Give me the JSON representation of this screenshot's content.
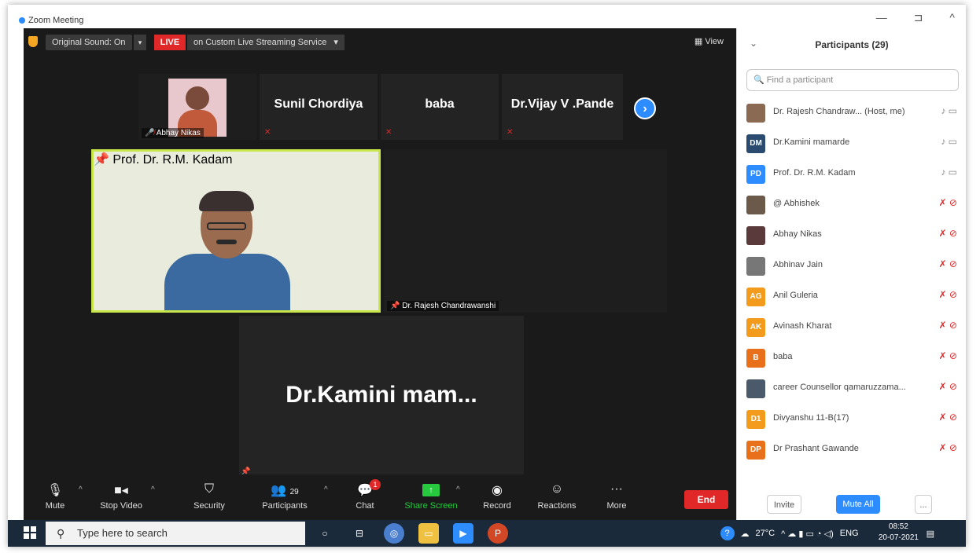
{
  "window": {
    "title": "Zoom Meeting",
    "minimize": "—",
    "restore": "⊐",
    "close": "^"
  },
  "topbar": {
    "original_sound": "Original Sound: On",
    "live": "LIVE",
    "stream": "on Custom Live Streaming Service",
    "view": "View"
  },
  "tiles": [
    {
      "name": "Abhay Nikas"
    },
    {
      "name": "Sunil Chordiya"
    },
    {
      "name": "baba"
    },
    {
      "name": "Dr.Vijay V .Pande"
    }
  ],
  "main_video": {
    "label": "Prof. Dr. R.M. Kadam"
  },
  "second_video": {
    "label": "Dr. Rajesh Chandrawanshi"
  },
  "third_video": {
    "name": "Dr.Kamini  mam..."
  },
  "toolbar": {
    "mute": "Mute",
    "stop_video": "Stop Video",
    "security": "Security",
    "participants": "Participants",
    "participants_count": "29",
    "chat": "Chat",
    "chat_badge": "1",
    "share_screen": "Share Screen",
    "record": "Record",
    "reactions": "Reactions",
    "more": "More",
    "end": "End"
  },
  "panel": {
    "title": "Participants (29)",
    "search_placeholder": "Find a participant",
    "participants": [
      {
        "initials": "",
        "name": "Dr. Rajesh Chandraw...  (Host, me)",
        "color": "#8a6a52",
        "muted": false
      },
      {
        "initials": "DM",
        "name": "Dr.Kamini mamarde",
        "color": "#2b4a6f",
        "muted": false
      },
      {
        "initials": "PD",
        "name": "Prof. Dr. R.M. Kadam",
        "color": "#2d8cff",
        "muted": false
      },
      {
        "initials": "",
        "name": "@ Abhishek",
        "color": "#6b5a4a",
        "muted": true
      },
      {
        "initials": "",
        "name": "Abhay Nikas",
        "color": "#5a3a3a",
        "muted": true
      },
      {
        "initials": "",
        "name": "Abhinav Jain",
        "color": "#777777",
        "muted": true
      },
      {
        "initials": "AG",
        "name": "Anil Guleria",
        "color": "#f29b1d",
        "muted": true
      },
      {
        "initials": "AK",
        "name": "Avinash Kharat",
        "color": "#f29b1d",
        "muted": true
      },
      {
        "initials": "B",
        "name": "baba",
        "color": "#e8701a",
        "muted": true
      },
      {
        "initials": "",
        "name": "career Counsellor qamaruzzama...",
        "color": "#4a5a6a",
        "muted": true
      },
      {
        "initials": "D1",
        "name": "Divyanshu 11-B(17)",
        "color": "#f29b1d",
        "muted": true
      },
      {
        "initials": "DP",
        "name": "Dr Prashant Gawande",
        "color": "#e8701a",
        "muted": true
      }
    ],
    "invite": "Invite",
    "mute_all": "Mute All",
    "more": "..."
  },
  "taskbar": {
    "search_placeholder": "Type here to search",
    "weather": "27°C",
    "lang": "ENG",
    "time": "08:52",
    "date": "20-07-2021"
  }
}
